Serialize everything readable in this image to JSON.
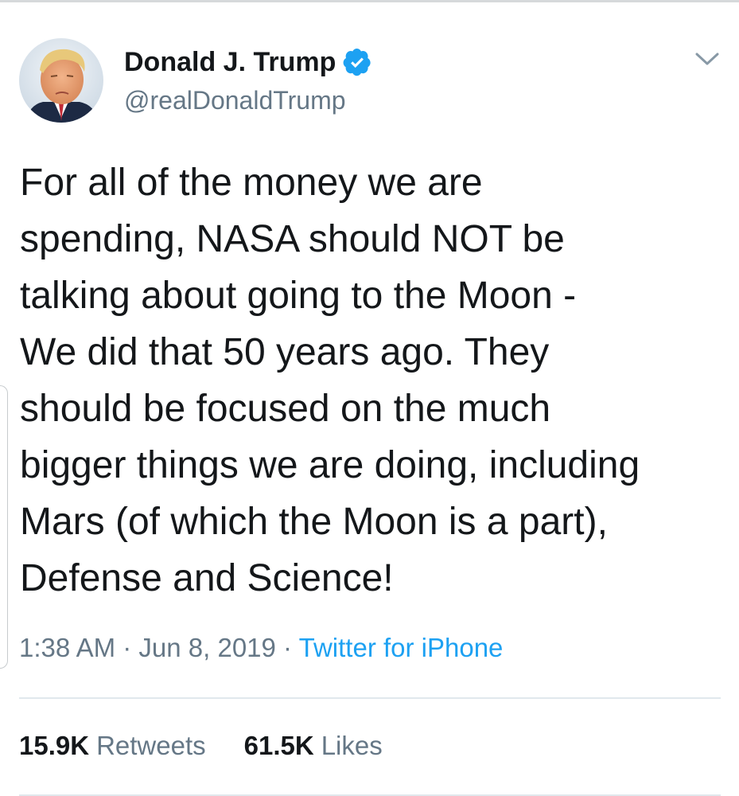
{
  "tweet": {
    "author": {
      "display_name": "Donald J. Trump",
      "handle": "@realDonaldTrump",
      "verified": true,
      "avatar_icon": "profile-photo",
      "verified_icon": "verified-badge-icon"
    },
    "menu_icon": "chevron-down-icon",
    "text_lines": [
      "For all of the money we are",
      "spending, NASA should NOT be",
      "talking about going to the Moon -",
      "We did that 50 years ago. They",
      "should be focused on the much",
      "bigger things we are doing, including",
      "Mars (of which the Moon is a part),",
      "Defense and Science!"
    ],
    "time": "1:38 AM",
    "separator": " · ",
    "date": "Jun 8, 2019",
    "source": "Twitter for iPhone",
    "stats": {
      "retweets_count": "15.9K",
      "retweets_label": "Retweets",
      "likes_count": "61.5K",
      "likes_label": "Likes"
    }
  },
  "colors": {
    "accent": "#1da1f2",
    "text_primary": "#14171a",
    "text_secondary": "#657786",
    "divider": "#e1e8ed"
  }
}
